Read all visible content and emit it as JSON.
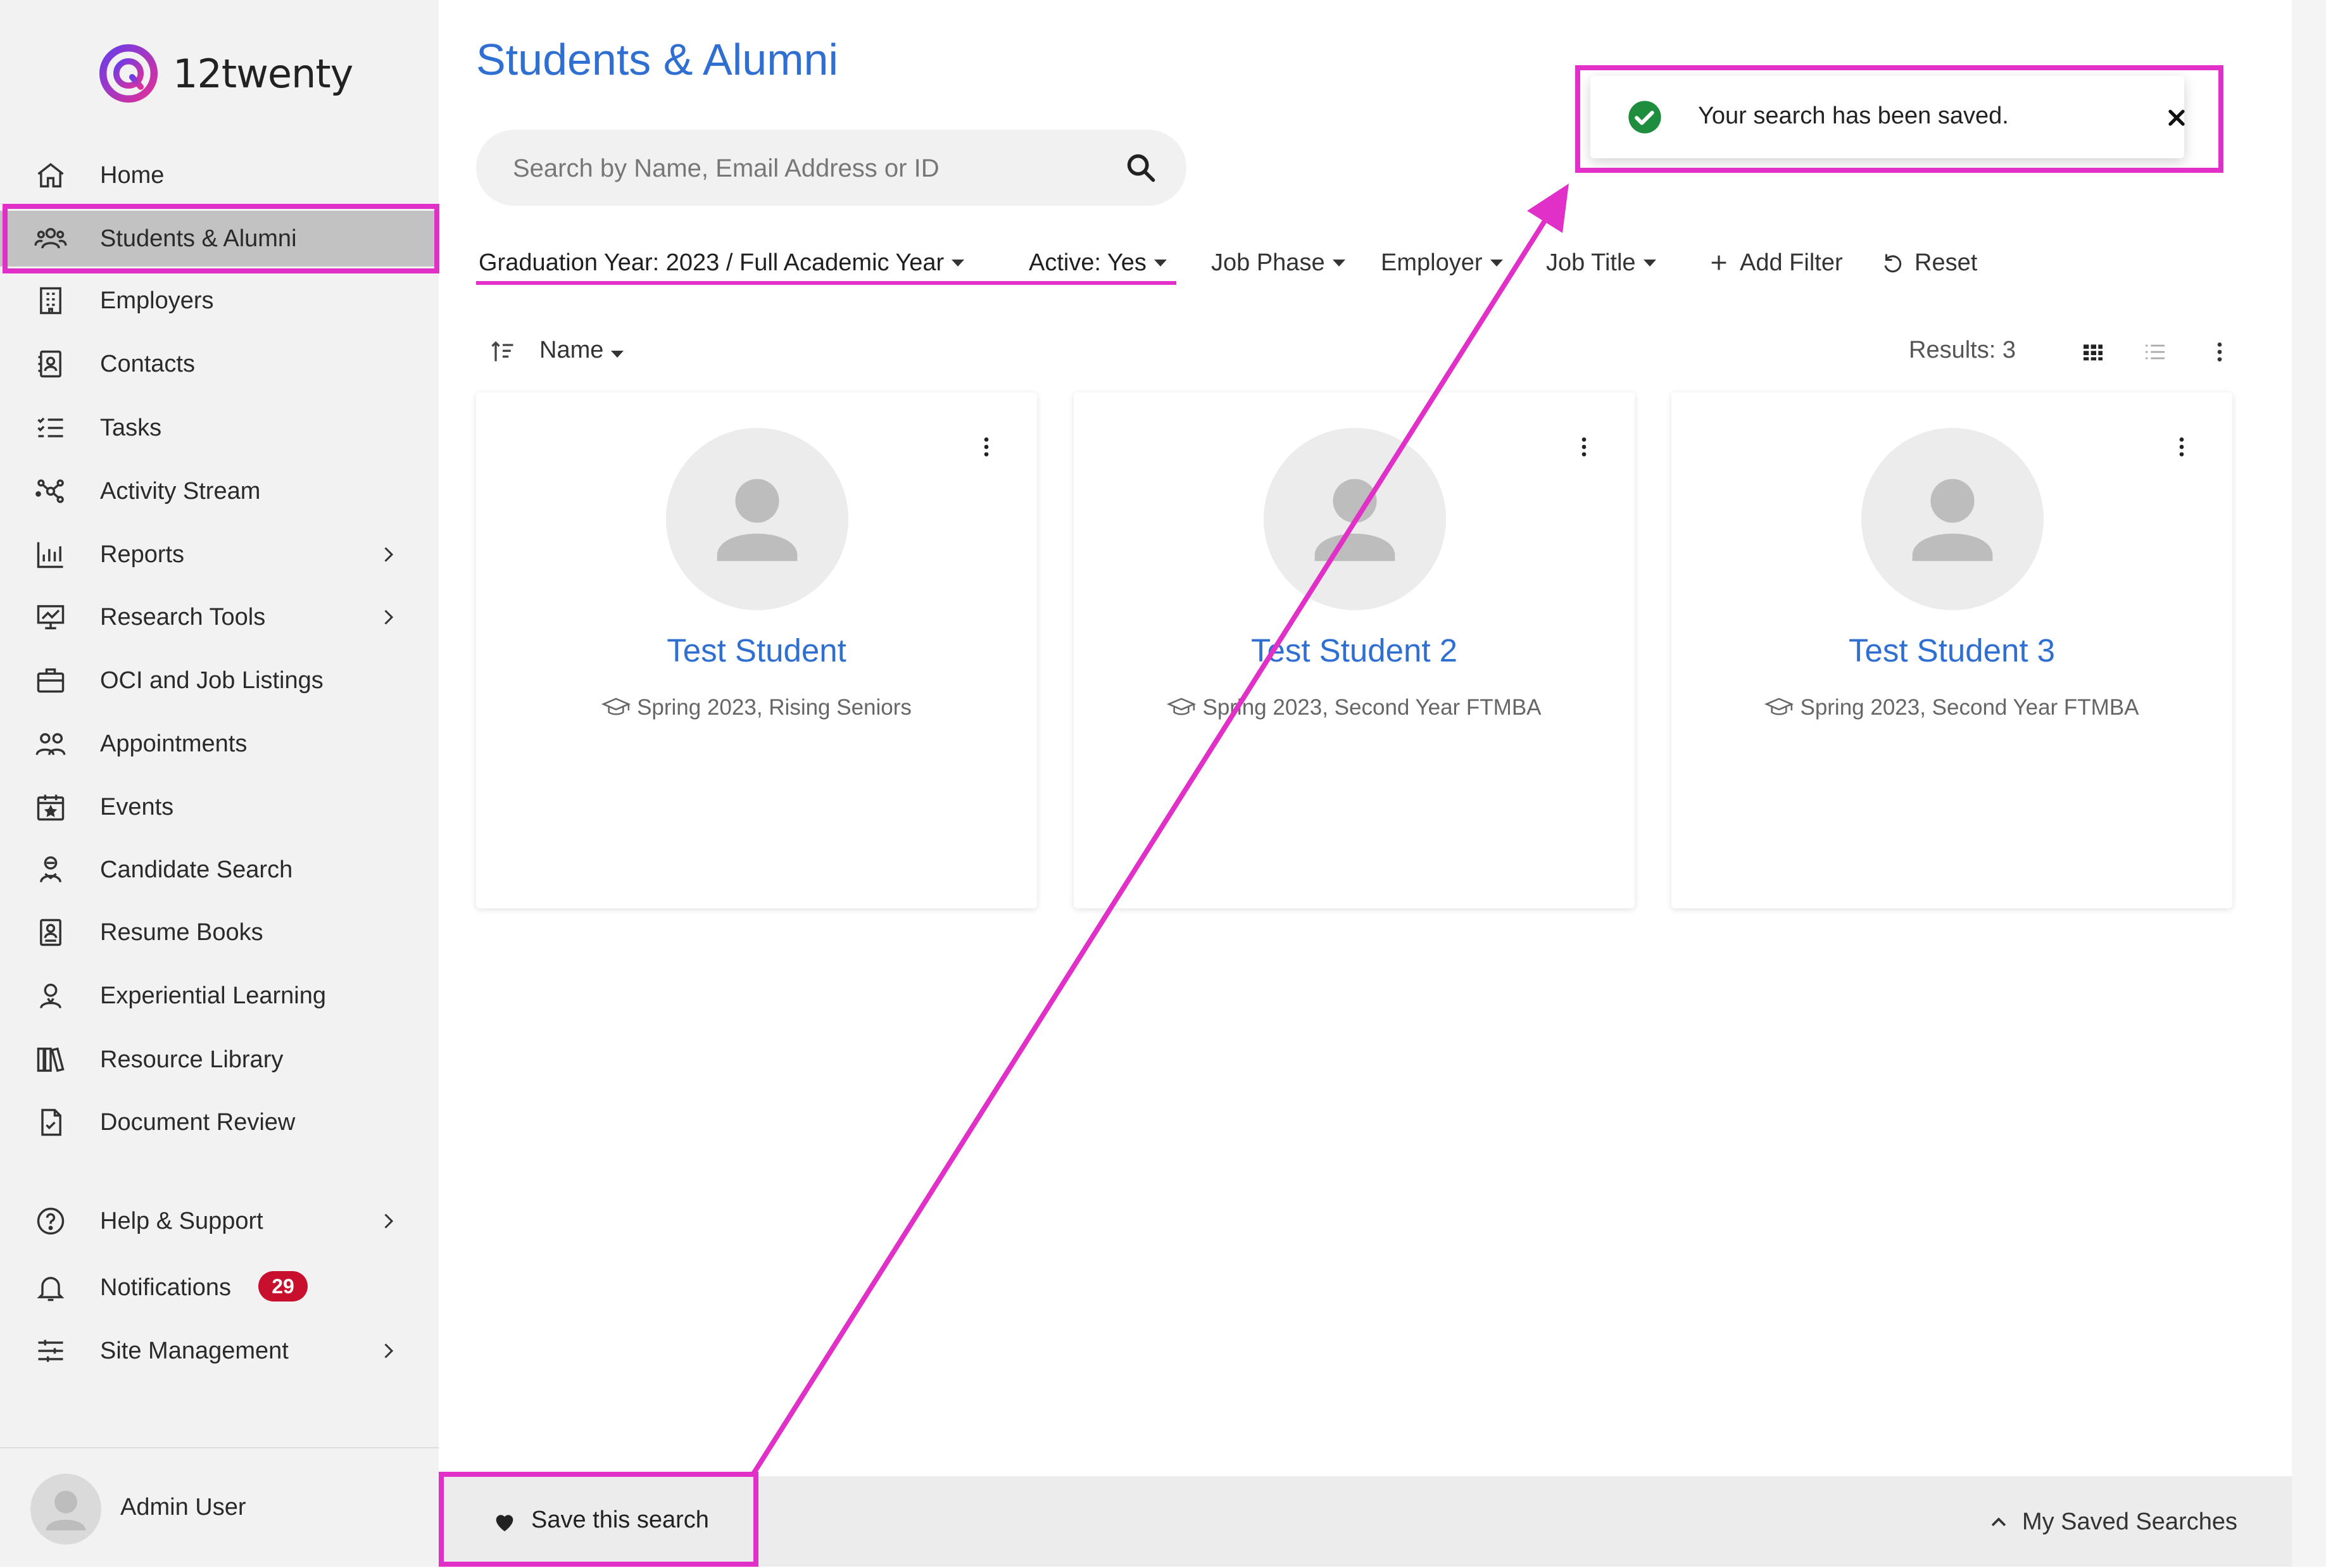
{
  "brand": {
    "name": "12twenty"
  },
  "sidebar": {
    "items": [
      {
        "label": "Home",
        "icon": "home-icon"
      },
      {
        "label": "Students & Alumni",
        "icon": "users-icon",
        "active": true
      },
      {
        "label": "Employers",
        "icon": "building-icon"
      },
      {
        "label": "Contacts",
        "icon": "contact-card-icon"
      },
      {
        "label": "Tasks",
        "icon": "checklist-icon"
      },
      {
        "label": "Activity Stream",
        "icon": "network-icon"
      },
      {
        "label": "Reports",
        "icon": "bar-chart-icon",
        "has_submenu": true
      },
      {
        "label": "Research Tools",
        "icon": "research-chart-icon",
        "has_submenu": true
      },
      {
        "label": "OCI and Job Listings",
        "icon": "briefcase-icon"
      },
      {
        "label": "Appointments",
        "icon": "people-icon"
      },
      {
        "label": "Events",
        "icon": "calendar-icon"
      },
      {
        "label": "Candidate Search",
        "icon": "candidate-icon"
      },
      {
        "label": "Resume Books",
        "icon": "resume-book-icon"
      },
      {
        "label": "Experiential Learning",
        "icon": "learner-icon"
      },
      {
        "label": "Resource Library",
        "icon": "library-icon"
      },
      {
        "label": "Document Review",
        "icon": "document-check-icon"
      },
      {
        "label": "Help & Support",
        "icon": "help-icon",
        "has_submenu": true
      },
      {
        "label": "Notifications",
        "icon": "bell-icon",
        "badge": "29"
      },
      {
        "label": "Site Management",
        "icon": "sliders-icon",
        "has_submenu": true
      }
    ],
    "user": {
      "name": "Admin User"
    }
  },
  "main": {
    "title": "Students & Alumni",
    "search": {
      "placeholder": "Search by Name, Email Address or ID",
      "value": ""
    },
    "filters": [
      {
        "label": "Graduation Year: 2023 / Full Academic Year",
        "active": true
      },
      {
        "label": "Active: Yes",
        "active": true
      },
      {
        "label": "Job Phase",
        "active": false
      },
      {
        "label": "Employer",
        "active": false
      },
      {
        "label": "Job Title",
        "active": false
      }
    ],
    "add_filter_label": "Add Filter",
    "reset_label": "Reset",
    "sort": {
      "label": "Name"
    },
    "results_label": "Results: 3",
    "cards": [
      {
        "name": "Test Student",
        "meta": "Spring 2023, Rising Seniors"
      },
      {
        "name": "Test Student 2",
        "meta": "Spring 2023, Second Year FTMBA"
      },
      {
        "name": "Test Student 3",
        "meta": "Spring 2023, Second Year FTMBA"
      }
    ]
  },
  "bottom_bar": {
    "save_label": "Save this search",
    "saved_searches_label": "My Saved Searches"
  },
  "toast": {
    "message": "Your search has been saved."
  },
  "colors": {
    "accent": "#2f6fd1",
    "annotation": "#e030c8",
    "badge": "#c8102e",
    "success": "#1e8e3e",
    "active_nav": "#c2c2c2"
  }
}
